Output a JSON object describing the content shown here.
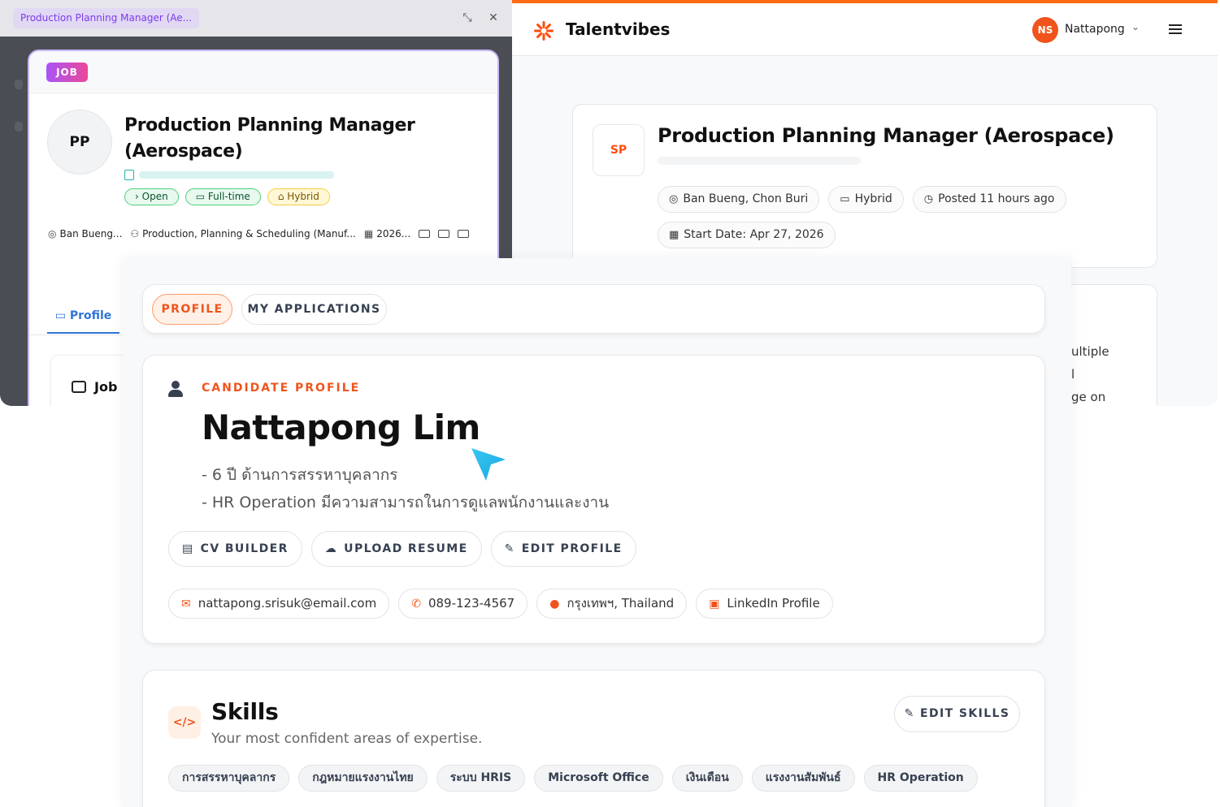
{
  "left_window": {
    "tab_title": "Production Planning Manager (Ae...",
    "minimize_glyph": "⤡",
    "close_glyph": "✕",
    "badge": "JOB",
    "avatar_initials": "PP",
    "job_title": "Production Planning Manager (Aerospace)",
    "tags": [
      {
        "icon": "chevron-right-icon",
        "label": "Open"
      },
      {
        "icon": "briefcase-icon",
        "label": "Full-time"
      },
      {
        "icon": "home-icon",
        "label": "Hybrid"
      }
    ],
    "meta": {
      "location": "Ban Bueng...",
      "category": "Production, Planning & Scheduling (Manuf...",
      "date": "2026..."
    },
    "tab_profile": "Profile",
    "section_label": "Job D"
  },
  "right_window": {
    "brand": "Talentvibes",
    "brand_color": "#ff4d0d",
    "user_initials": "NS",
    "user_name": "Nattapong",
    "company_initials": "SP",
    "job_title": "Production Planning Manager (Aerospace)",
    "chips": [
      {
        "icon": "map-pin-icon",
        "label": "Ban Bueng, Chon Buri"
      },
      {
        "icon": "briefcase-icon",
        "label": "Hybrid"
      },
      {
        "icon": "clock-calendar-icon",
        "label": "Posted 11 hours ago"
      },
      {
        "icon": "calendar-icon",
        "label": "Start Date: Apr 27, 2026"
      }
    ],
    "peek_lines": [
      "ultiple",
      "l",
      "ge on"
    ]
  },
  "profile": {
    "tabs": [
      {
        "label": "PROFILE",
        "active": true
      },
      {
        "label": "MY APPLICATIONS",
        "active": false
      }
    ],
    "eyebrow": "CANDIDATE PROFILE",
    "name": "Nattapong Lim",
    "bio": [
      "- 6 ปี ด้านการสรรหาบุคลากร",
      "- HR Operation มีความสามารถในการดูแลพนักงานและงาน"
    ],
    "actions": [
      {
        "icon": "document-icon",
        "label": "CV BUILDER"
      },
      {
        "icon": "cloud-upload-icon",
        "label": "UPLOAD RESUME"
      },
      {
        "icon": "edit-icon",
        "label": "EDIT PROFILE"
      }
    ],
    "contacts": [
      {
        "icon": "envelope-icon",
        "label": "nattapong.srisuk@email.com"
      },
      {
        "icon": "phone-icon",
        "label": "089-123-4567"
      },
      {
        "icon": "map-pin-icon",
        "label": "กรุงเทพฯ, Thailand"
      },
      {
        "icon": "linkedin-icon",
        "label": "LinkedIn Profile"
      }
    ],
    "accent_color": "#f0541c"
  },
  "skills": {
    "title": "Skills",
    "subtitle": "Your most confident areas of expertise.",
    "edit_label": "EDIT SKILLS",
    "items": [
      "การสรรหาบุคลากร",
      "กฎหมายแรงงานไทย",
      "ระบบ HRIS",
      "Microsoft Office",
      "เงินเดือน",
      "แรงงานสัมพันธ์",
      "HR Operation"
    ]
  }
}
